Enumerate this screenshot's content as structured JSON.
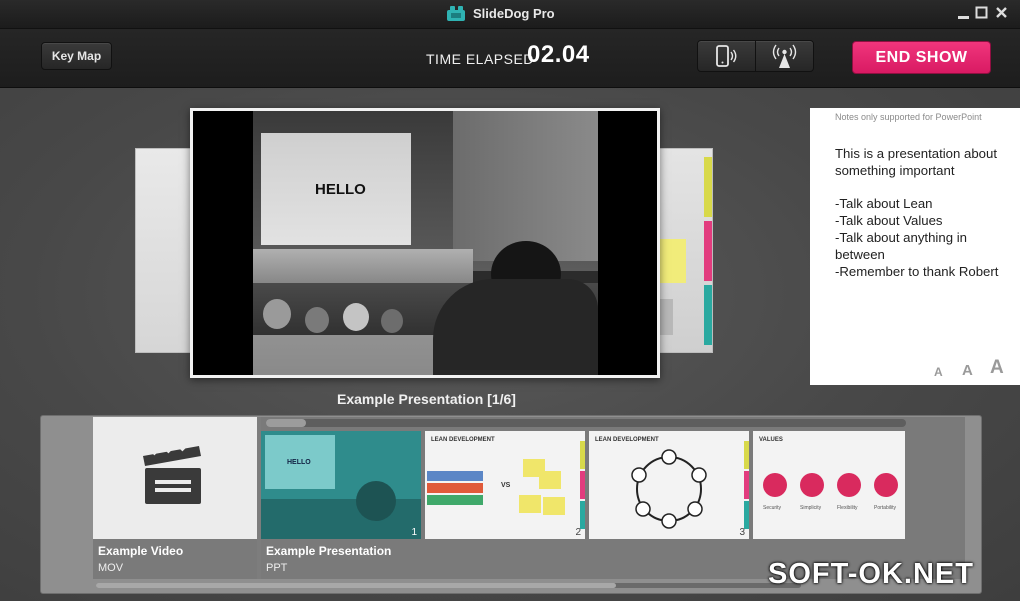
{
  "window": {
    "title": "SlideDog Pro",
    "controls": [
      "minimize",
      "maximize",
      "close"
    ]
  },
  "toolbar": {
    "keymap_label": "Key Map",
    "elapsed_label": "TIME ELAPSED",
    "elapsed_value": "02.04",
    "remote_buttons": [
      "phone-remote-icon",
      "broadcast-icon"
    ],
    "end_show_label": "END SHOW"
  },
  "colors": {
    "accent_pink": "#e8266f",
    "strip_bg": "#8f8f8f",
    "teal_tint": "#3fa5a5"
  },
  "slide": {
    "text": "HELLO",
    "caption": "Example Presentation [1/6]"
  },
  "notes": {
    "hint": "Notes only supported for PowerPoint",
    "body": "This is a presentation about something important\n\n-Talk about Lean\n-Talk about Values\n-Talk about anything in between\n-Remember to thank Robert",
    "font_sizes": [
      "A",
      "A",
      "A"
    ]
  },
  "playlist": [
    {
      "title": "Example Video",
      "type": "MOV"
    },
    {
      "title": "Example Presentation",
      "type": "PPT",
      "slides": [
        {
          "num": "1",
          "heading": "HELLO"
        },
        {
          "num": "2",
          "heading": "LEAN DEVELOPMENT",
          "vs": "VS"
        },
        {
          "num": "3",
          "heading": "LEAN DEVELOPMENT"
        },
        {
          "num": "",
          "heading": "VALUES",
          "labels": [
            "Security",
            "Simplicity",
            "Flexibility",
            "Portability"
          ]
        }
      ]
    }
  ],
  "watermark": "SOFT-OK.NET"
}
